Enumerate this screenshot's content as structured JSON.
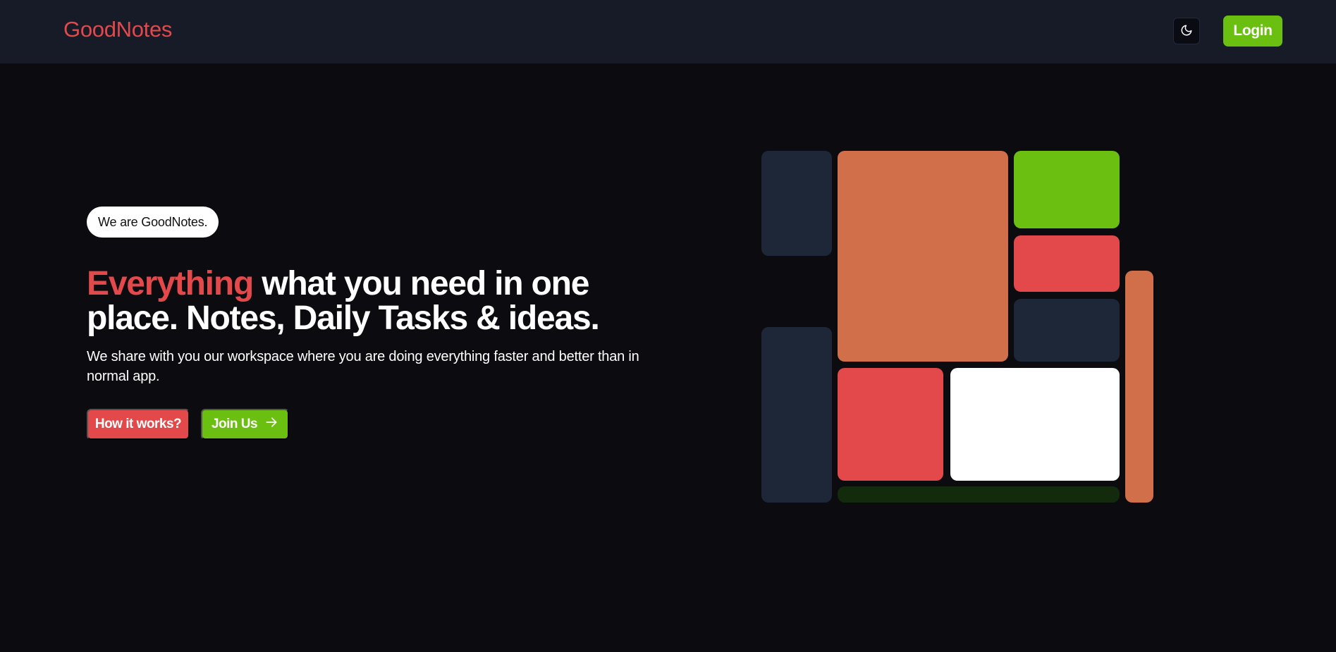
{
  "header": {
    "logo": "GoodNotes",
    "theme_toggle_icon": "moon-icon",
    "login_label": "Login"
  },
  "hero": {
    "badge": "We are GoodNotes.",
    "headline_accent": "Everything",
    "headline_rest": " what you need in one place. Notes, Daily Tasks & ideas.",
    "subtext": "We share with you our workspace where you are doing everything faster and better than in normal app.",
    "how_label": "How it works?",
    "join_label": "Join Us",
    "join_icon": "arrow-right-icon"
  },
  "colors": {
    "background": "#0b0b10",
    "navbar": "#171b28",
    "accent_red": "#e3484a",
    "accent_green": "#6abf10",
    "orange": "#d16f4a",
    "slate": "#1e2738",
    "dark_green": "#132a0c",
    "white": "#ffffff"
  }
}
